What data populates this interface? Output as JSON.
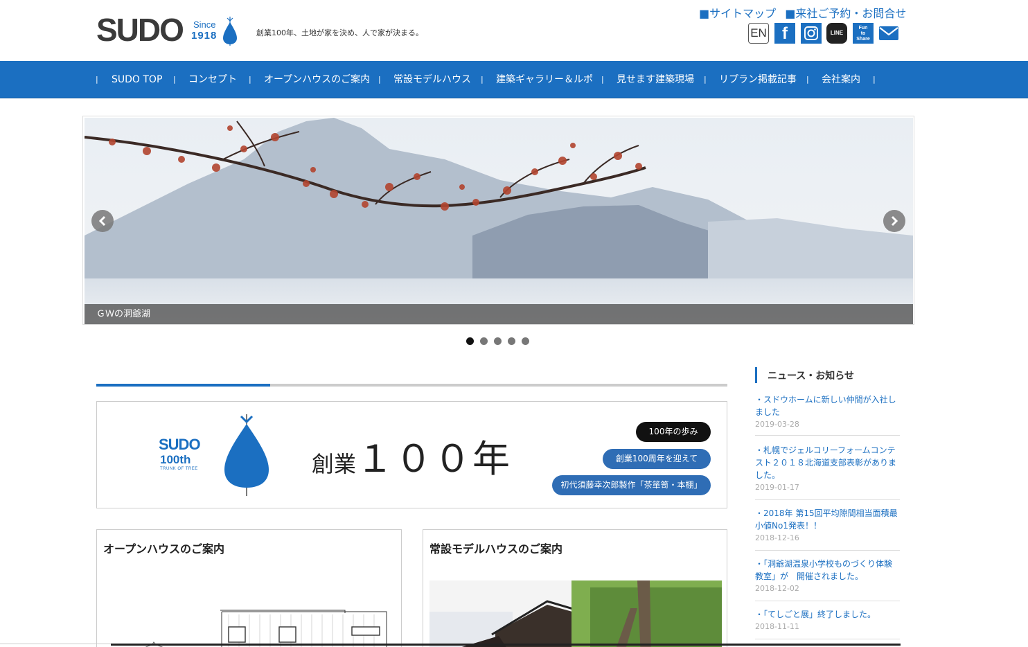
{
  "header": {
    "logo_word": "SUDO",
    "logo_since": "Since",
    "logo_year": "1918",
    "tagline": "創業100年、土地が家を決め、人で家が決まる。",
    "top_links": [
      "■サイトマップ",
      "■来社ご予約・お問合せ"
    ],
    "social": {
      "en_label": "EN",
      "facebook_label": "f",
      "line_label": "LINE",
      "fun_label_1": "Fun",
      "fun_label_2": "to",
      "fun_label_3": "Share"
    }
  },
  "nav": {
    "separator": "|",
    "items": [
      "SUDO TOP",
      "コンセプト",
      "オープンハウスのご案内",
      "常設モデルハウス",
      "建築ギャラリー＆ルポ",
      "見せます建築現場",
      "リプラン掲載記事",
      "会社案内"
    ]
  },
  "slider": {
    "caption": "ＧＷの洞爺湖",
    "slide_count": 5,
    "active_index": 0
  },
  "banner": {
    "logo_sudo": "SUDO",
    "logo_100th": "100th",
    "logo_trunk": "TRUNK OF TREE",
    "title_prefix": "創業",
    "title_number": "１００年",
    "buttons": [
      "100年の歩み",
      "創業100周年を迎えて",
      "初代須藤幸次郎製作「茶箪笥・本棚」"
    ]
  },
  "cards": [
    {
      "title": "オープンハウスのご案内"
    },
    {
      "title": "常設モデルハウスのご案内"
    }
  ],
  "news": {
    "heading": "ニュース・お知らせ",
    "items": [
      {
        "title": "・スドウホームに新しい仲間が入社しました",
        "date": "2019-03-28"
      },
      {
        "title": "・札幌でジェルコリーフォームコンテスト２０１８北海道支部表彰がありました。",
        "date": "2019-01-17"
      },
      {
        "title": "・2018年 第15回平均隙間相当面積最小値No1発表！！",
        "date": "2018-12-16"
      },
      {
        "title": "・「洞爺湖温泉小学校ものづくり体験教室」が　開催されました。",
        "date": "2018-12-02"
      },
      {
        "title": "・「てしごと展」終了しました。",
        "date": "2018-11-11"
      }
    ]
  },
  "colors": {
    "brand_blue": "#1b6fc1",
    "pill_blue": "#2f6db5",
    "text_dark": "#333333"
  }
}
